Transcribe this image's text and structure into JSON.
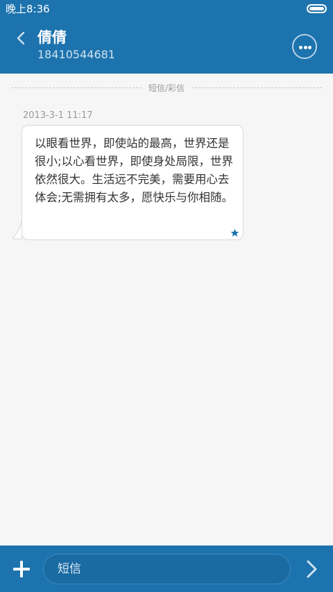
{
  "status_bar": {
    "time": "晚上8:36",
    "battery_level": 1.0
  },
  "header": {
    "contact_name": "倩倩",
    "phone_number": "18410544681",
    "back_icon": "chevron-left-icon",
    "more_icon": "more-horizontal-icon"
  },
  "thread": {
    "divider_label": "短信/彩信",
    "messages": [
      {
        "timestamp": "2013-3-1 11:17",
        "text": "以眼看世界，即使站的最高，世界还是很小;以心看世界，即使身处局限，世界依然很大。生活远不完美，需要用心去体会;无需拥有太多，愿快乐与你相随。",
        "starred": true
      }
    ]
  },
  "composer": {
    "add_icon": "plus-icon",
    "input_placeholder": "短信",
    "input_value": "",
    "send_icon": "chevron-right-icon"
  },
  "colors": {
    "primary": "#1d73ad",
    "background": "#f6f6f6",
    "bubble": "#ffffff",
    "star": "#1d73ad"
  }
}
